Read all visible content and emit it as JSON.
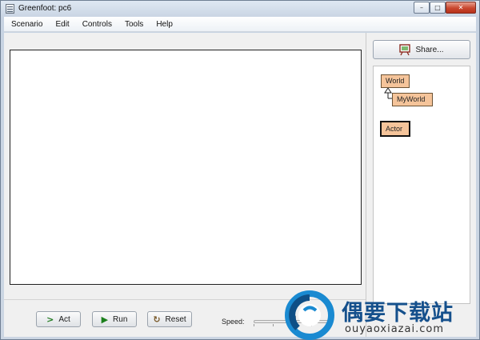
{
  "window": {
    "title": "Greenfoot: pc6",
    "controls": {
      "minimize": "–",
      "maximize": "□",
      "close": "✕"
    }
  },
  "menubar": {
    "items": [
      "Scenario",
      "Edit",
      "Controls",
      "Tools",
      "Help"
    ]
  },
  "share": {
    "label": "Share..."
  },
  "classes": {
    "world": "World",
    "myworld": "MyWorld",
    "actor": "Actor"
  },
  "controls": {
    "act_label": "Act",
    "run_label": "Run",
    "reset_label": "Reset",
    "speed_label": "Speed:",
    "speed_fraction": 0.5
  },
  "watermark": {
    "name": "偶要下载站",
    "url": "ouyaoxiazai.com"
  },
  "icons": {
    "act": "act-arrow-icon",
    "run": "play-triangle-icon",
    "reset": "reset-circular-arrow-icon",
    "share": "share-easel-icon"
  },
  "colors": {
    "class_box": "#f5c49a",
    "run_green": "#1c7f1c",
    "watermark_blue": "#15508c"
  }
}
